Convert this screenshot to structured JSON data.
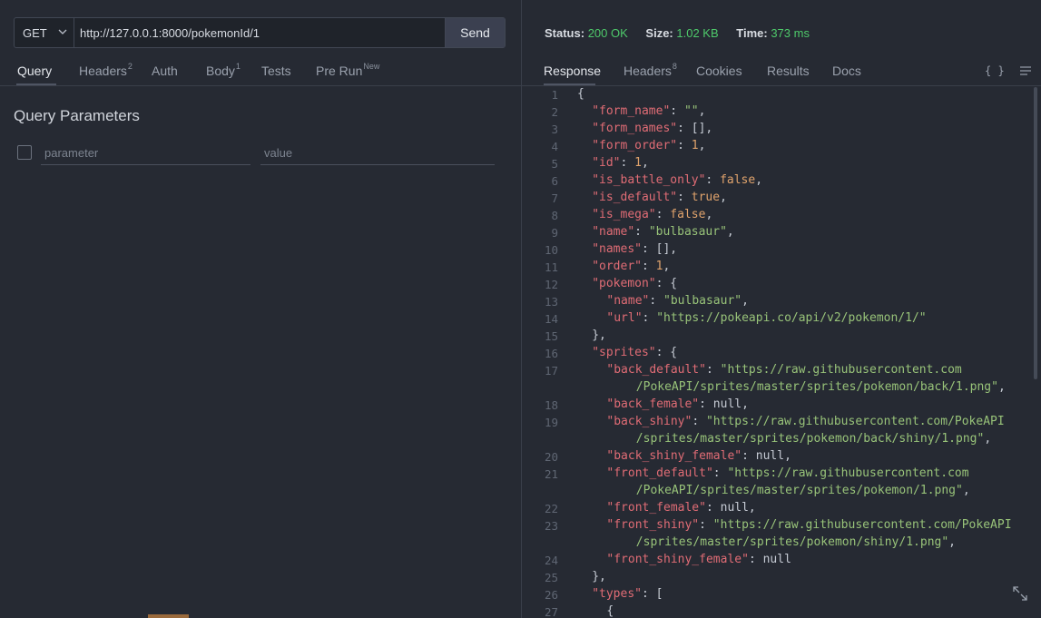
{
  "request": {
    "method": "GET",
    "url": "http://127.0.0.1:8000/pokemonId/1",
    "send_label": "Send",
    "tabs": [
      {
        "label": "Query",
        "badge": ""
      },
      {
        "label": "Headers",
        "badge": "2"
      },
      {
        "label": "Auth",
        "badge": ""
      },
      {
        "label": "Body",
        "badge": "1"
      },
      {
        "label": "Tests",
        "badge": ""
      },
      {
        "label": "Pre Run",
        "badge": "New"
      }
    ],
    "query_params": {
      "title": "Query Parameters",
      "parameter_placeholder": "parameter",
      "value_placeholder": "value"
    }
  },
  "response": {
    "status_label": "Status:",
    "status_value": "200 OK",
    "size_label": "Size:",
    "size_value": "1.02 KB",
    "time_label": "Time:",
    "time_value": "373 ms",
    "tabs": [
      {
        "label": "Response",
        "badge": ""
      },
      {
        "label": "Headers",
        "badge": "8"
      },
      {
        "label": "Cookies",
        "badge": ""
      },
      {
        "label": "Results",
        "badge": ""
      },
      {
        "label": "Docs",
        "badge": ""
      }
    ],
    "braces_label": "{ }",
    "code_lines": [
      {
        "n": "1",
        "indent": 0,
        "parts": [
          [
            "p",
            "{"
          ]
        ]
      },
      {
        "n": "2",
        "indent": 1,
        "parts": [
          [
            "k",
            "\"form_name\""
          ],
          [
            "p",
            ": "
          ],
          [
            "s",
            "\"\""
          ],
          [
            "p",
            ","
          ]
        ]
      },
      {
        "n": "3",
        "indent": 1,
        "parts": [
          [
            "k",
            "\"form_names\""
          ],
          [
            "p",
            ": [],"
          ]
        ]
      },
      {
        "n": "4",
        "indent": 1,
        "parts": [
          [
            "k",
            "\"form_order\""
          ],
          [
            "p",
            ": "
          ],
          [
            "n",
            "1"
          ],
          [
            "p",
            ","
          ]
        ]
      },
      {
        "n": "5",
        "indent": 1,
        "parts": [
          [
            "k",
            "\"id\""
          ],
          [
            "p",
            ": "
          ],
          [
            "n",
            "1"
          ],
          [
            "p",
            ","
          ]
        ]
      },
      {
        "n": "6",
        "indent": 1,
        "parts": [
          [
            "k",
            "\"is_battle_only\""
          ],
          [
            "p",
            ": "
          ],
          [
            "b",
            "false"
          ],
          [
            "p",
            ","
          ]
        ]
      },
      {
        "n": "7",
        "indent": 1,
        "parts": [
          [
            "k",
            "\"is_default\""
          ],
          [
            "p",
            ": "
          ],
          [
            "b",
            "true"
          ],
          [
            "p",
            ","
          ]
        ]
      },
      {
        "n": "8",
        "indent": 1,
        "parts": [
          [
            "k",
            "\"is_mega\""
          ],
          [
            "p",
            ": "
          ],
          [
            "b",
            "false"
          ],
          [
            "p",
            ","
          ]
        ]
      },
      {
        "n": "9",
        "indent": 1,
        "parts": [
          [
            "k",
            "\"name\""
          ],
          [
            "p",
            ": "
          ],
          [
            "s",
            "\"bulbasaur\""
          ],
          [
            "p",
            ","
          ]
        ]
      },
      {
        "n": "10",
        "indent": 1,
        "parts": [
          [
            "k",
            "\"names\""
          ],
          [
            "p",
            ": [],"
          ]
        ]
      },
      {
        "n": "11",
        "indent": 1,
        "parts": [
          [
            "k",
            "\"order\""
          ],
          [
            "p",
            ": "
          ],
          [
            "n",
            "1"
          ],
          [
            "p",
            ","
          ]
        ]
      },
      {
        "n": "12",
        "indent": 1,
        "parts": [
          [
            "k",
            "\"pokemon\""
          ],
          [
            "p",
            ": {"
          ]
        ]
      },
      {
        "n": "13",
        "indent": 2,
        "parts": [
          [
            "k",
            "\"name\""
          ],
          [
            "p",
            ": "
          ],
          [
            "s",
            "\"bulbasaur\""
          ],
          [
            "p",
            ","
          ]
        ]
      },
      {
        "n": "14",
        "indent": 2,
        "parts": [
          [
            "k",
            "\"url\""
          ],
          [
            "p",
            ": "
          ],
          [
            "s",
            "\"https://pokeapi.co/api/v2/pokemon/1/\""
          ]
        ]
      },
      {
        "n": "15",
        "indent": 1,
        "parts": [
          [
            "p",
            "},"
          ]
        ]
      },
      {
        "n": "16",
        "indent": 1,
        "parts": [
          [
            "k",
            "\"sprites\""
          ],
          [
            "p",
            ": {"
          ]
        ]
      },
      {
        "n": "17",
        "indent": 2,
        "parts": [
          [
            "k",
            "\"back_default\""
          ],
          [
            "p",
            ": "
          ],
          [
            "s",
            "\"https://raw.githubusercontent.com"
          ]
        ]
      },
      {
        "n": "",
        "indent": 4,
        "parts": [
          [
            "s",
            "/PokeAPI/sprites/master/sprites/pokemon/back/1.png\""
          ],
          [
            "p",
            ","
          ]
        ]
      },
      {
        "n": "18",
        "indent": 2,
        "parts": [
          [
            "k",
            "\"back_female\""
          ],
          [
            "p",
            ": null,"
          ]
        ]
      },
      {
        "n": "19",
        "indent": 2,
        "parts": [
          [
            "k",
            "\"back_shiny\""
          ],
          [
            "p",
            ": "
          ],
          [
            "s",
            "\"https://raw.githubusercontent.com/PokeAPI"
          ]
        ]
      },
      {
        "n": "",
        "indent": 4,
        "parts": [
          [
            "s",
            "/sprites/master/sprites/pokemon/back/shiny/1.png\""
          ],
          [
            "p",
            ","
          ]
        ]
      },
      {
        "n": "20",
        "indent": 2,
        "parts": [
          [
            "k",
            "\"back_shiny_female\""
          ],
          [
            "p",
            ": null,"
          ]
        ]
      },
      {
        "n": "21",
        "indent": 2,
        "parts": [
          [
            "k",
            "\"front_default\""
          ],
          [
            "p",
            ": "
          ],
          [
            "s",
            "\"https://raw.githubusercontent.com"
          ]
        ]
      },
      {
        "n": "",
        "indent": 4,
        "parts": [
          [
            "s",
            "/PokeAPI/sprites/master/sprites/pokemon/1.png\""
          ],
          [
            "p",
            ","
          ]
        ]
      },
      {
        "n": "22",
        "indent": 2,
        "parts": [
          [
            "k",
            "\"front_female\""
          ],
          [
            "p",
            ": null,"
          ]
        ]
      },
      {
        "n": "23",
        "indent": 2,
        "parts": [
          [
            "k",
            "\"front_shiny\""
          ],
          [
            "p",
            ": "
          ],
          [
            "s",
            "\"https://raw.githubusercontent.com/PokeAPI"
          ]
        ]
      },
      {
        "n": "",
        "indent": 4,
        "parts": [
          [
            "s",
            "/sprites/master/sprites/pokemon/shiny/1.png\""
          ],
          [
            "p",
            ","
          ]
        ]
      },
      {
        "n": "24",
        "indent": 2,
        "parts": [
          [
            "k",
            "\"front_shiny_female\""
          ],
          [
            "p",
            ": null"
          ]
        ]
      },
      {
        "n": "25",
        "indent": 1,
        "parts": [
          [
            "p",
            "},"
          ]
        ]
      },
      {
        "n": "26",
        "indent": 1,
        "parts": [
          [
            "k",
            "\"types\""
          ],
          [
            "p",
            ": ["
          ]
        ]
      },
      {
        "n": "27",
        "indent": 2,
        "parts": [
          [
            "p",
            "{"
          ]
        ]
      }
    ]
  },
  "colors": {
    "background": "#262a33",
    "status_ok": "#4ec96a",
    "json_key": "#e06c75",
    "json_string": "#98c379",
    "json_literal": "#e0a36c"
  }
}
